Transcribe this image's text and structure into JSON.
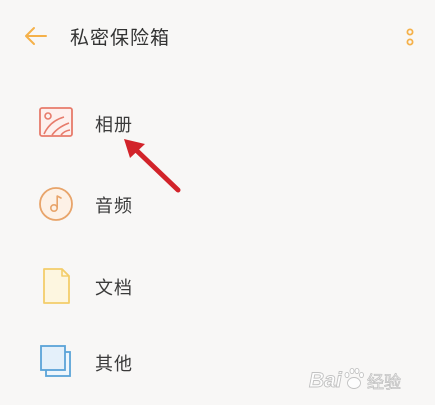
{
  "header": {
    "title": "私密保险箱",
    "back_icon": "arrow-left-icon",
    "more_icon": "more-vertical-icon"
  },
  "items": [
    {
      "label": "相册",
      "icon": "album-image-icon"
    },
    {
      "label": "音频",
      "icon": "music-note-icon"
    },
    {
      "label": "文档",
      "icon": "document-icon"
    },
    {
      "label": "其他",
      "icon": "other-folder-icon"
    }
  ],
  "colors": {
    "accent": "#f5b14a",
    "album_icon": "#e77b6b",
    "audio_icon": "#e8a46a",
    "document_icon": "#f3cd6a",
    "other_icon": "#5aa3d8",
    "annotation_arrow": "#d2232a"
  },
  "watermark": {
    "brand": "Baidu",
    "caption": "经验"
  }
}
